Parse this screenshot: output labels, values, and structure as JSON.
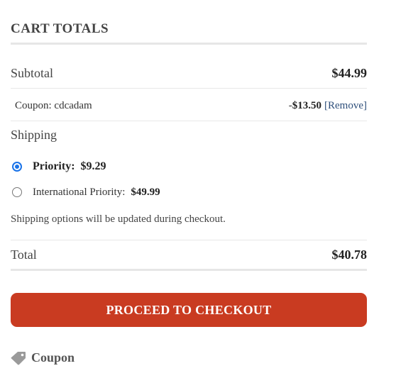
{
  "cart_totals": {
    "title": "CART TOTALS",
    "subtotal": {
      "label": "Subtotal",
      "value": "$44.99"
    },
    "coupon": {
      "label": "Coupon: cdcadam",
      "prefix": "-",
      "amount": "$13.50",
      "remove_label": "[Remove]"
    },
    "shipping": {
      "label": "Shipping",
      "options": [
        {
          "name": "Priority:",
          "price": "$9.29",
          "selected": true
        },
        {
          "name": "International Priority:",
          "price": "$49.99",
          "selected": false
        }
      ],
      "note": "Shipping options will be updated during checkout."
    },
    "total": {
      "label": "Total",
      "value": "$40.78"
    },
    "checkout_label": "PROCEED TO CHECKOUT",
    "coupon_toggle": {
      "label": "Coupon",
      "icon": "tag-icon"
    }
  },
  "colors": {
    "accent": "#c93b21",
    "link": "#2d4e7a",
    "radio": "#1a73e8"
  }
}
